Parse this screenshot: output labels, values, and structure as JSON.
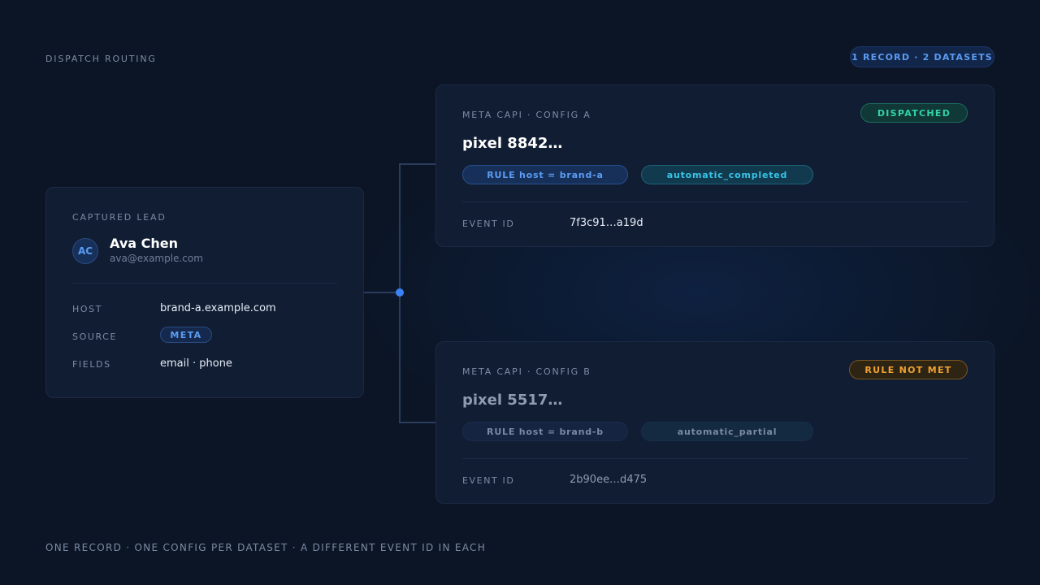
{
  "header": {
    "title": "DISPATCH ROUTING",
    "badge": "1 RECORD · 2 DATASETS"
  },
  "lead": {
    "section_label": "CAPTURED LEAD",
    "avatar_initials": "AC",
    "name": "Ava Chen",
    "email": "ava@example.com",
    "host_label": "HOST",
    "host_value": "brand-a.example.com",
    "source_label": "SOURCE",
    "source_value": "META",
    "fields_label": "FIELDS",
    "fields_value": "email · phone"
  },
  "datasets": [
    {
      "label": "META CAPI · CONFIG A",
      "status": "DISPATCHED",
      "pixel": "pixel 8842…",
      "rule": "RULE host = brand-a",
      "event_type": "automatic_completed",
      "event_id_label": "EVENT ID",
      "event_id": "7f3c91…a19d"
    },
    {
      "label": "META CAPI · CONFIG B",
      "status": "RULE NOT MET",
      "pixel": "pixel 5517…",
      "rule": "RULE host = brand-b",
      "event_type": "automatic_partial",
      "event_id_label": "EVENT ID",
      "event_id": "2b90ee…d475"
    }
  ],
  "footer": {
    "note": "ONE RECORD · ONE CONFIG PER DATASET · A DIFFERENT EVENT ID IN EACH"
  },
  "colors": {
    "background": "#0b1526",
    "accent": "#3b82f6",
    "success": "#34d3a6",
    "warning": "#f0a233"
  }
}
